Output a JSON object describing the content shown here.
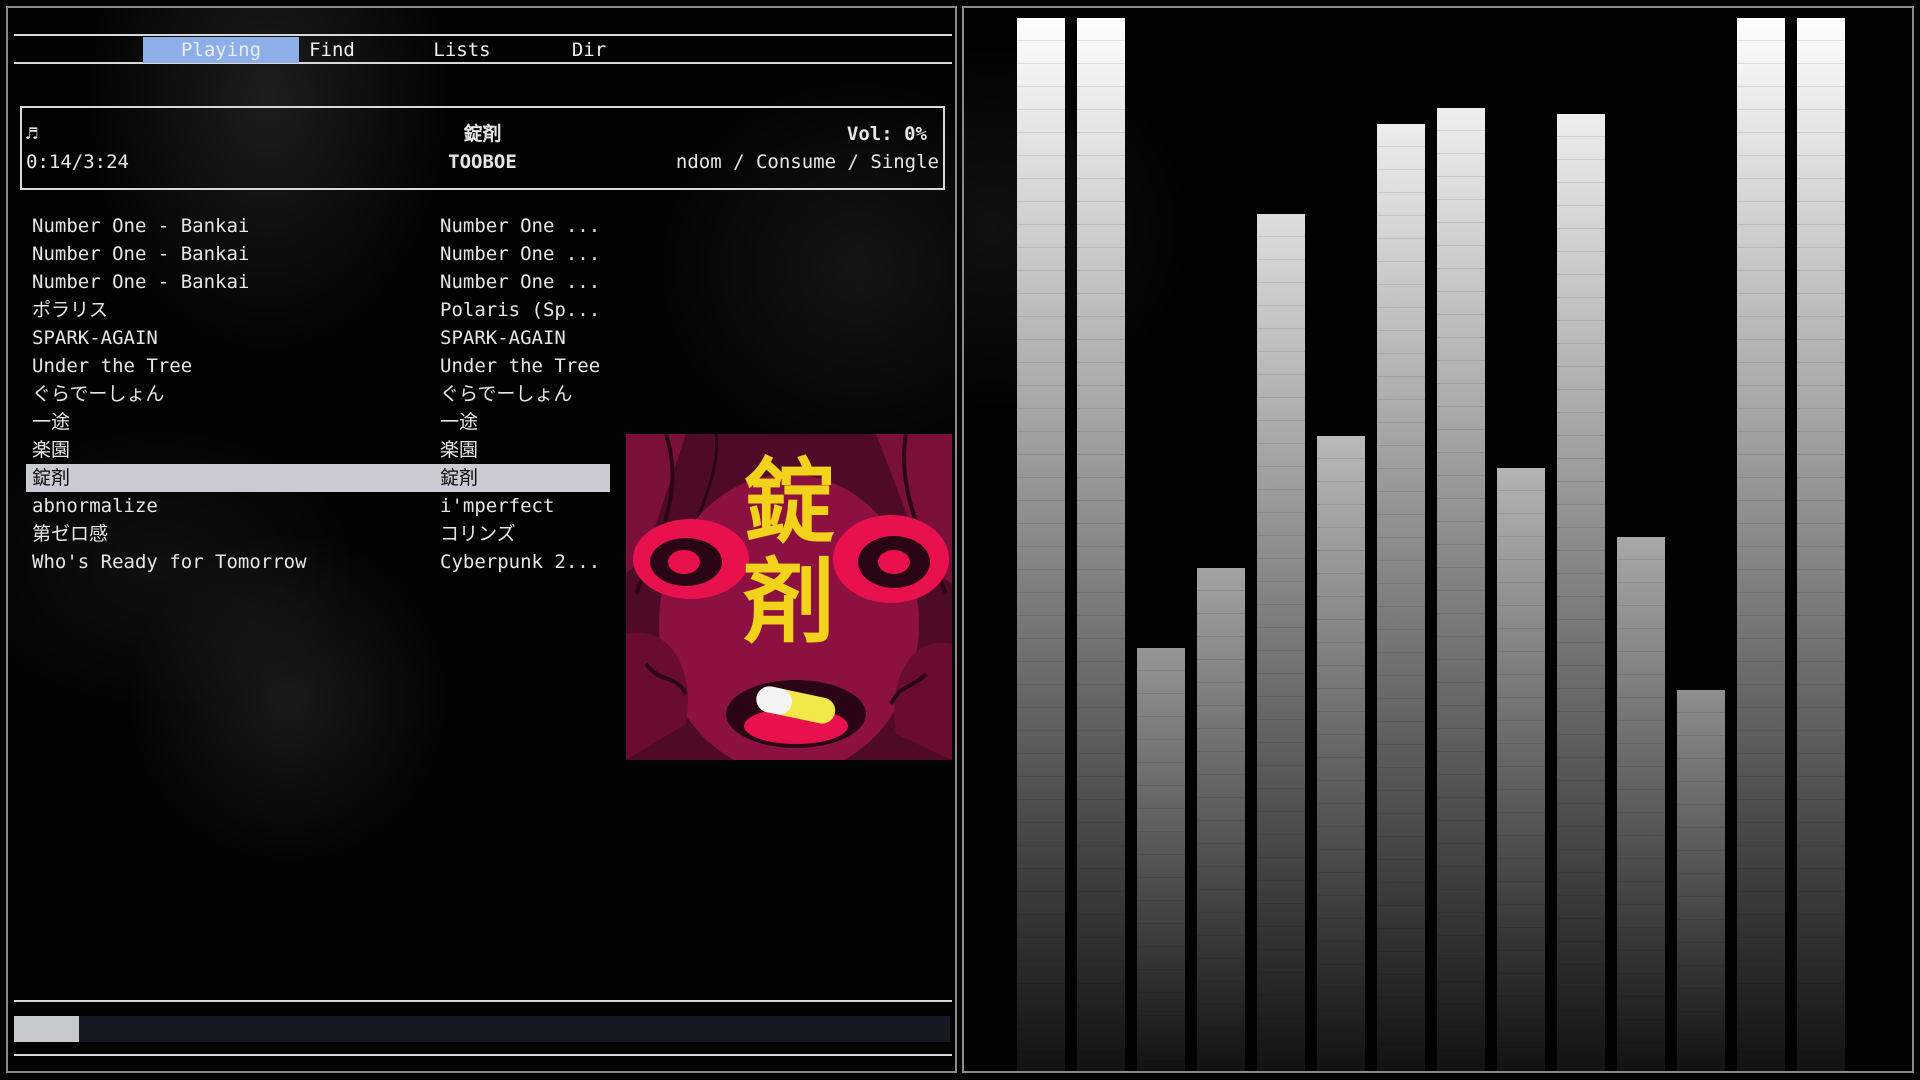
{
  "tabs": [
    {
      "label": "Playing",
      "active": true
    },
    {
      "label": "Find",
      "active": false
    },
    {
      "label": "Lists",
      "active": false
    },
    {
      "label": "Dir",
      "active": false
    }
  ],
  "now_playing": {
    "icon": "music-note-icon",
    "note_glyph": "♬",
    "elapsed_total": "0:14/3:24",
    "title": "錠剤",
    "artist": "TOOBOE",
    "volume": "Vol: 0%",
    "modes": "ndom / Consume / Single"
  },
  "tracks": [
    {
      "title": "Number One - Bankai",
      "album": "Number One ..."
    },
    {
      "title": "Number One - Bankai",
      "album": "Number One ..."
    },
    {
      "title": "Number One - Bankai",
      "album": "Number One ..."
    },
    {
      "title": "ポラリス",
      "album": "Polaris (Sp..."
    },
    {
      "title": "SPARK-AGAIN",
      "album": "SPARK-AGAIN"
    },
    {
      "title": "Under the Tree",
      "album": "Under the Tree"
    },
    {
      "title": "ぐらでーしょん",
      "album": "ぐらでーしょん"
    },
    {
      "title": "一途",
      "album": "一途"
    },
    {
      "title": "楽園",
      "album": "楽園"
    },
    {
      "title": "錠剤",
      "album": "錠剤",
      "selected": true
    },
    {
      "title": "abnormalize",
      "album": "i'mperfect"
    },
    {
      "title": "第ゼロ感",
      "album": "コリンズ"
    },
    {
      "title": "Who's Ready for Tomorrow",
      "album": "Cyberpunk 2..."
    }
  ],
  "cover_art": {
    "text": "錠剤",
    "colors": {
      "bg": "#5a0d2e",
      "accent": "#e8114e",
      "text": "#f2d21b",
      "pill": "#f3e84a"
    }
  },
  "progress": {
    "fraction": 0.069
  },
  "visualizer": {
    "levels": [
      0.995,
      0.995,
      0.4,
      0.475,
      0.81,
      0.6,
      0.895,
      0.91,
      0.57,
      0.905,
      0.505,
      0.36,
      0.995,
      0.995
    ]
  },
  "colors": {
    "tab_active": "#8daee6",
    "selection": "#c9ccd2",
    "border": "#d8d8d8"
  }
}
